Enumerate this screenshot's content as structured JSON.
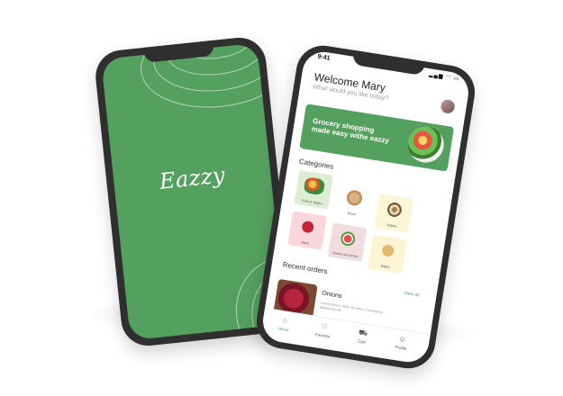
{
  "splash": {
    "brand": "Eazzy",
    "bg_color": "#54a15f"
  },
  "home": {
    "status": {
      "time": "9:41",
      "icons": "▂▄▆ ◠ ▭"
    },
    "greeting": "Welcome Mary",
    "subtitle": "What would you like today?",
    "avatar_icon": "user-avatar",
    "banner": {
      "text": "Grocery shopping made easy withe eazzy",
      "color": "#54a15f"
    },
    "categories_title": "Categories",
    "categories": [
      {
        "label": "Fruits & Vegies",
        "color": "#dbeed4"
      },
      {
        "label": "Bread",
        "color": "#ffffff"
      },
      {
        "label": "Staples",
        "color": "#fbf6d5"
      },
      {
        "label": "Meat",
        "color": "#f9d7db"
      },
      {
        "label": "Snacks and drinks",
        "color": "#f1dde0"
      },
      {
        "label": "Bakes",
        "color": "#fdf4d3"
      }
    ],
    "recent_title": "Recent orders",
    "view_all": "View all",
    "order": {
      "title": "Onions",
      "description": "Lorem ipsum dolor sit amet consectetur adipiscing elit"
    },
    "nav": [
      {
        "label": "Home",
        "icon": "home-icon",
        "glyph": "⌂"
      },
      {
        "label": "Favorite",
        "icon": "heart-icon",
        "glyph": "♡"
      },
      {
        "label": "Cart",
        "icon": "cart-icon",
        "glyph": "⛟"
      },
      {
        "label": "Profile",
        "icon": "profile-icon",
        "glyph": "☺"
      }
    ],
    "accent": "#54a15f"
  }
}
